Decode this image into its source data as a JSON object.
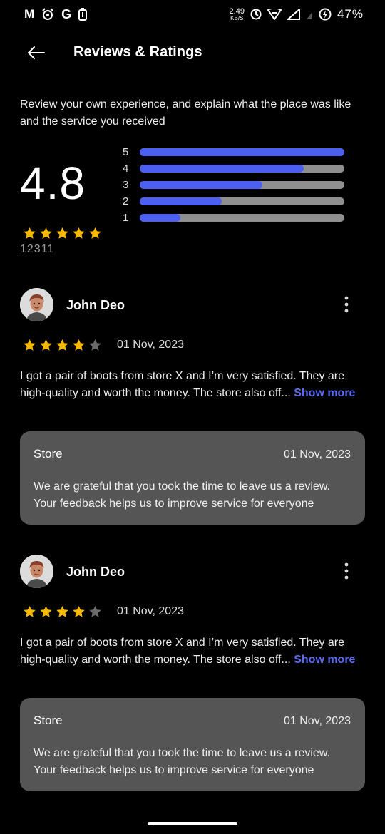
{
  "status": {
    "left_icons": [
      "M",
      "alarm",
      "G",
      "battery-saver"
    ],
    "speed_value": "2.49",
    "speed_unit": "KB/S",
    "battery": "47%"
  },
  "header": {
    "title": "Reviews & Ratings"
  },
  "summary": {
    "intro": "Review your own experience, and explain what the place was like and the service you received",
    "average": "4.8",
    "count": "12311",
    "stars_filled": 5,
    "distribution": [
      {
        "label": "5",
        "fraction": 1.0
      },
      {
        "label": "4",
        "fraction": 0.8
      },
      {
        "label": "3",
        "fraction": 0.6
      },
      {
        "label": "2",
        "fraction": 0.4
      },
      {
        "label": "1",
        "fraction": 0.2
      }
    ],
    "bar_color": "#4b5ff0",
    "track_color": "#8f8f8f"
  },
  "reviews": [
    {
      "name": "John Deo",
      "rating": 4,
      "date": "01 Nov, 2023",
      "text": "I got a pair of boots from store X and I’m very satisfied. They are high-quality and worth the money. The store also off... ",
      "show_more": "Show more",
      "reply": {
        "title": "Store",
        "date": "01 Nov, 2023",
        "text": "We are grateful that you took the time to leave us a review. Your feedback helps us to improve service for everyone"
      }
    },
    {
      "name": "John Deo",
      "rating": 4,
      "date": "01 Nov, 2023",
      "text": "I got a pair of boots from store X and I’m very satisfied. They are high-quality and worth the money. The store also off... ",
      "show_more": "Show more",
      "reply": {
        "title": "Store",
        "date": "01 Nov, 2023",
        "text": "We are grateful that you took the time to leave us a review. Your feedback helps us to improve service for everyone"
      }
    }
  ]
}
